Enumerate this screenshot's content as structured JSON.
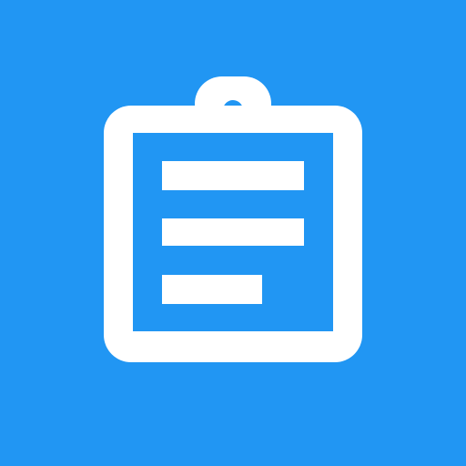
{
  "icon": {
    "name": "clipboard-icon",
    "background_color": "#2196F3",
    "foreground_color": "#FFFFFF",
    "text_lines": 3
  }
}
